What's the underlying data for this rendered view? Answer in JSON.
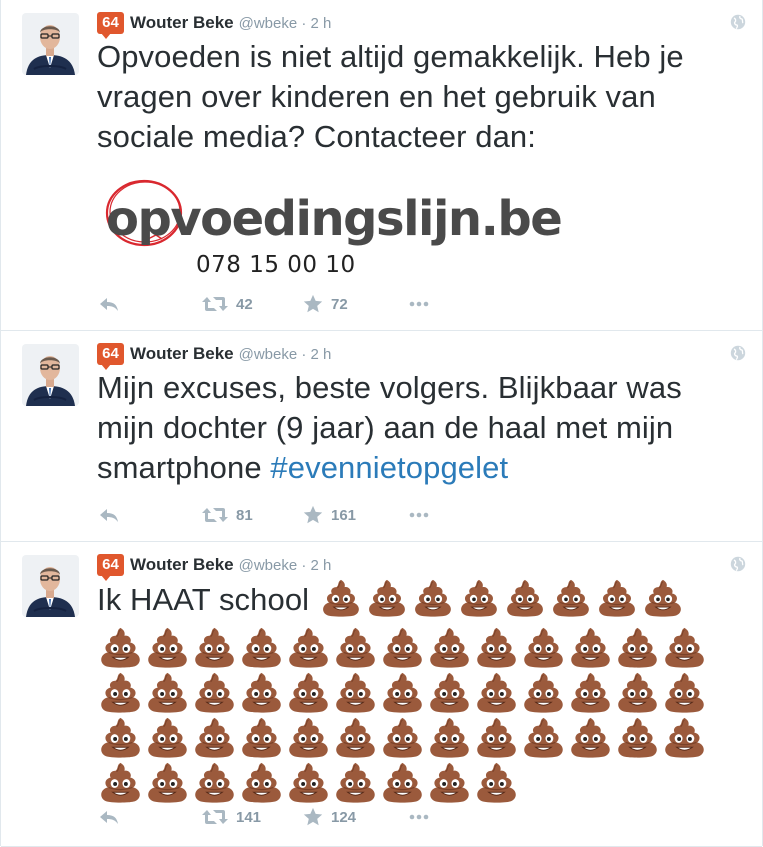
{
  "tweets": [
    {
      "badge": "64",
      "name": "Wouter Beke",
      "handle": "@wbeke",
      "time": "2 h",
      "text": "Opvoeden is niet altijd gemakkelijk. Heb je vragen over kinderen en het gebruik van sociale media? Contacteer dan:",
      "logo": {
        "name": "opvoedingslijn.be",
        "phone": "078 15 00 10"
      },
      "retweets": "42",
      "favorites": "72"
    },
    {
      "badge": "64",
      "name": "Wouter Beke",
      "handle": "@wbeke",
      "time": "2 h",
      "text": "Mijn excuses, beste volgers. Blijkbaar was mijn dochter (9 jaar) aan de haal met mijn smartphone ",
      "hashtag": "#evennietopgelet",
      "retweets": "81",
      "favorites": "161"
    },
    {
      "badge": "64",
      "name": "Wouter Beke",
      "handle": "@wbeke",
      "time": "2 h",
      "text": "Ik HAAT school",
      "emoji": "pile-of-poo",
      "inline_emoji_count": 8,
      "emoji_row_counts": [
        13,
        13,
        13,
        9
      ],
      "retweets": "141",
      "favorites": "124"
    }
  ],
  "colors": {
    "badge": "#e0572d",
    "name": "#292f33",
    "muted": "#8899a6",
    "hashtag": "#2b7bb9",
    "divider": "#e1e8ed",
    "logo_circle": "#d9282f"
  },
  "icons": [
    "reply-icon",
    "retweet-icon",
    "favorite-star-icon",
    "more-dots-icon",
    "globe-icon"
  ]
}
